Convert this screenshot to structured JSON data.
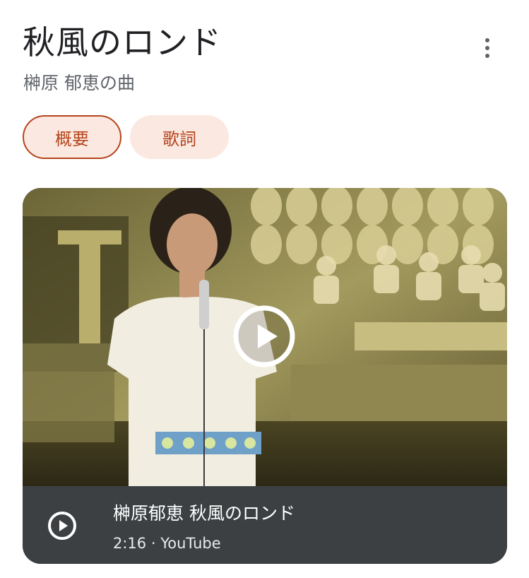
{
  "header": {
    "title": "秋風のロンド",
    "subtitle": "榊原 郁恵の曲",
    "more_icon": "more-vert-icon"
  },
  "chips": [
    {
      "label": "概要",
      "selected": true
    },
    {
      "label": "歌詞",
      "selected": false
    }
  ],
  "video": {
    "title": "榊原郁恵 秋風のロンド",
    "duration": "2:16",
    "separator": "·",
    "source": "YouTube",
    "play_icon": "play-circle-icon",
    "accent_color": "#b5441c",
    "chip_bg_color": "#fbe9e1",
    "info_bar_color": "#3c4043"
  }
}
